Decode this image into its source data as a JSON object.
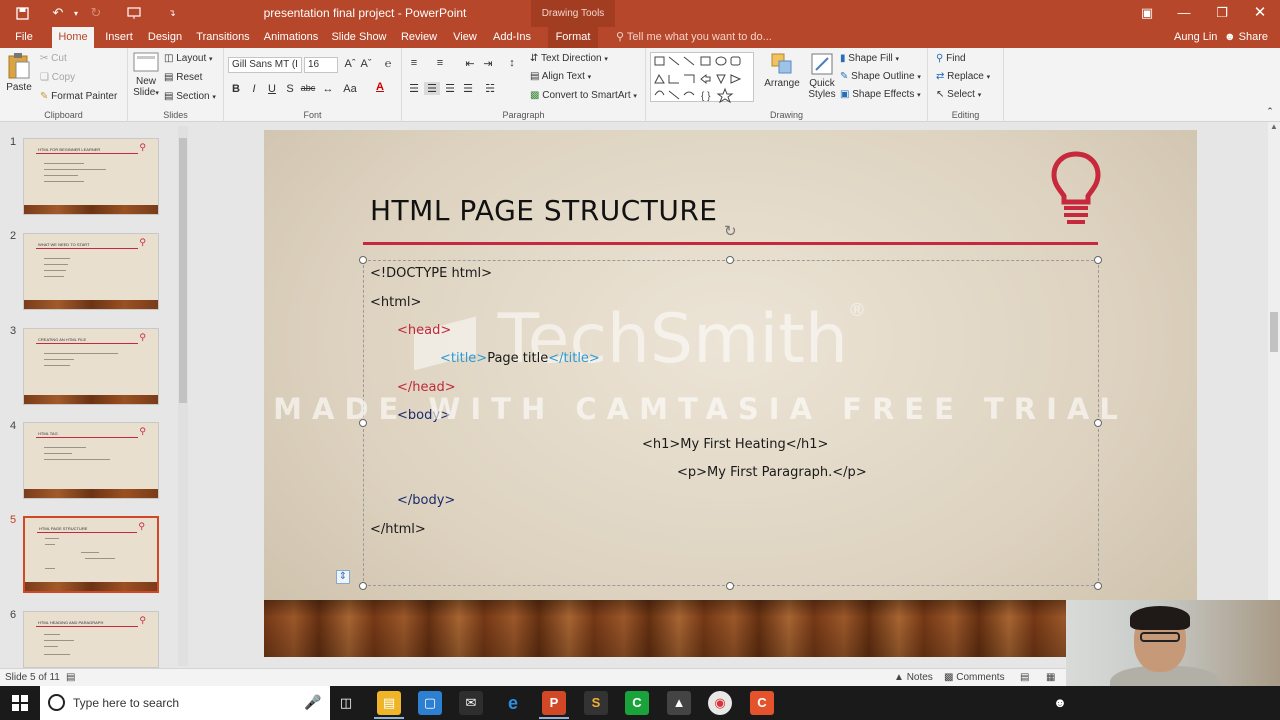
{
  "window": {
    "doc_title": "presentation final project - PowerPoint",
    "contextual_tools": "Drawing Tools"
  },
  "tabs": [
    {
      "label": "File"
    },
    {
      "label": "Home"
    },
    {
      "label": "Insert"
    },
    {
      "label": "Design"
    },
    {
      "label": "Transitions"
    },
    {
      "label": "Animations"
    },
    {
      "label": "Slide Show"
    },
    {
      "label": "Review"
    },
    {
      "label": "View"
    },
    {
      "label": "Add-Ins"
    },
    {
      "label": "Format"
    }
  ],
  "tell_me": "Tell me what you want to do...",
  "user": {
    "name": "Aung Lin",
    "share": "Share"
  },
  "ribbon": {
    "clipboard": {
      "paste": "Paste",
      "cut": "Cut",
      "copy": "Copy",
      "format_painter": "Format Painter",
      "label": "Clipboard"
    },
    "slides": {
      "new_slide": "New Slide",
      "new_slide_line2": "Slide",
      "new_slide_line1": "New",
      "layout": "Layout",
      "reset": "Reset",
      "section": "Section",
      "label": "Slides"
    },
    "font": {
      "font_name": "Gill Sans MT (I",
      "font_size": "16",
      "label": "Font"
    },
    "paragraph": {
      "text_direction": "Text Direction",
      "align_text": "Align Text",
      "convert_smartart": "Convert to SmartArt",
      "label": "Paragraph"
    },
    "drawing": {
      "arrange": "Arrange",
      "quick_styles_1": "Quick",
      "quick_styles_2": "Styles",
      "shape_fill": "Shape Fill",
      "shape_outline": "Shape Outline",
      "shape_effects": "Shape Effects",
      "label": "Drawing"
    },
    "editing": {
      "find": "Find",
      "replace": "Replace",
      "select": "Select",
      "label": "Editing"
    }
  },
  "thumbnails": [
    {
      "num": "1",
      "title": "HTML FOR BEGINNER LEARNER"
    },
    {
      "num": "2",
      "title": "WHAT WE NEED TO START"
    },
    {
      "num": "3",
      "title": "CREATING AN HTML FILE"
    },
    {
      "num": "4",
      "title": "HTML TAG"
    },
    {
      "num": "5",
      "title": "HTML PAGE STRUCTURE"
    },
    {
      "num": "6",
      "title": "HTML HEADING AND PARAGRAPH"
    }
  ],
  "slide": {
    "title": "HTML PAGE STRUCTURE",
    "lines": [
      "<!DOCTYPE html>",
      "<html>",
      "<head>",
      "<title>",
      "Page title",
      "</title>",
      "</head>",
      "<body>",
      "<h1>My First Heating</h1>",
      "<p>My First Paragraph.</p>",
      "</body>",
      "</html>"
    ]
  },
  "watermark": {
    "brand": "TechSmith",
    "registered": "®",
    "notice": "MADE WITH CAMTASIA FREE TRIAL"
  },
  "status": {
    "slide_of": "Slide 5 of 11",
    "notes": "Notes",
    "comments": "Comments"
  },
  "taskbar": {
    "search_placeholder": "Type here to search"
  },
  "colors": {
    "accent": "#b7472a",
    "slide_red": "#c7283d",
    "selected_thumb": "#d24726"
  }
}
